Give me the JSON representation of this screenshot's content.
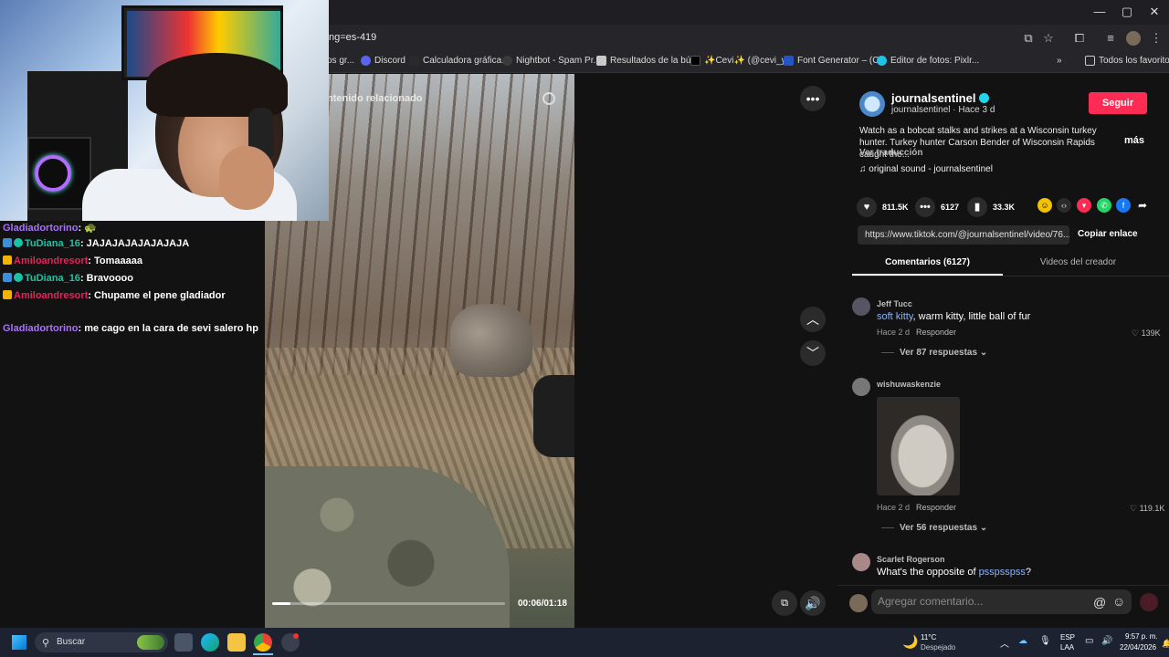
{
  "browser": {
    "url": "ng=es-419",
    "window_controls": [
      "—",
      "▢",
      "✕"
    ],
    "bookmarks": [
      {
        "label": "os gr...",
        "color": "#ffffff00"
      },
      {
        "label": "Discord",
        "color": "#5865f2"
      },
      {
        "label": "Calculadora gráfica...",
        "color": "#2a2a2a"
      },
      {
        "label": "Nightbot - Spam Pr...",
        "color": "#3a3a3a"
      },
      {
        "label": "Resultados de la bú...",
        "color": "#c9c9c9"
      },
      {
        "label": "✨Cevi✨ (@cevi_y...",
        "color": "#000000"
      },
      {
        "label": "Font Generator – (C...",
        "color": "#2355c4"
      },
      {
        "label": "Editor de fotos: Pixlr...",
        "color": "#23c1e6"
      }
    ],
    "bookmarks_overflow": "»",
    "all_bookmarks": "Todos los favoritos"
  },
  "chat": {
    "messages": [
      {
        "user": "Gladiadortorino",
        "color": "#a970ff",
        "badge": "",
        "text": ": 🐢"
      },
      {
        "user": "TuDiana_16",
        "color": "#19c4a6",
        "badge": "#3a8fd9",
        "text": ": JAJAJAJAJAJAJAJA"
      },
      {
        "user": "Amiloandresort",
        "color": "#e0245e",
        "badge": "#f2b400",
        "text": ": Tomaaaaa"
      },
      {
        "user": "TuDiana_16",
        "color": "#19c4a6",
        "badge": "#3a8fd9",
        "text": ": Bravoooo"
      },
      {
        "user": "Amiloandresort",
        "color": "#e0245e",
        "badge": "#f2b400",
        "text": ": Chupame el pene gladiador"
      },
      {
        "user": "Gladiadortorino",
        "color": "#a970ff",
        "badge": "",
        "text": ": me cago en la cara de sevi salero hp"
      }
    ]
  },
  "video": {
    "related_label": "ntenido relacionado",
    "time": "00:06/01:18",
    "progress_fraction": 0.08
  },
  "post": {
    "username": "journalsentinel",
    "subline": "journalsentinel · Hace 3 d",
    "follow": "Seguir",
    "description": "Watch as a bobcat stalks and strikes at a Wisconsin turkey hunter. Turkey hunter Carson Bender of Wisconsin Rapids caught the...",
    "more": "más",
    "translate": "Ver traducción",
    "sound": "original sound - journalsentinel",
    "likes": "811.5K",
    "comments": "6127",
    "saves": "33.3K",
    "link": "https://www.tiktok.com/@journalsentinel/video/76...",
    "copy_link": "Copiar enlace",
    "tab_comments": "Comentarios (6127)",
    "tab_videos": "Videos del creador"
  },
  "comments": [
    {
      "name": "Jeff Tucc",
      "link": "soft kitty",
      "text": ", warm kitty, little ball of fur",
      "time": "Hace 2 d",
      "reply": "Responder",
      "likes": "139K",
      "replies": "Ver 87 respuestas"
    },
    {
      "name": "wishuwaskenzie",
      "time": "Hace 2 d",
      "reply": "Responder",
      "likes": "119.1K",
      "replies": "Ver 56 respuestas"
    },
    {
      "name": "Scarlet Rogerson",
      "text": "What's the opposite of ",
      "link": "psspsspss",
      "text_after": "?"
    }
  ],
  "comment_input": {
    "placeholder": "Agregar comentario..."
  },
  "taskbar": {
    "search": "Buscar",
    "weather_temp": "11°C",
    "weather_desc": "Despejado",
    "lang_1": "ESP",
    "lang_2": "LAA",
    "time": "9:57 p. m.",
    "date": "22/04/2026"
  }
}
